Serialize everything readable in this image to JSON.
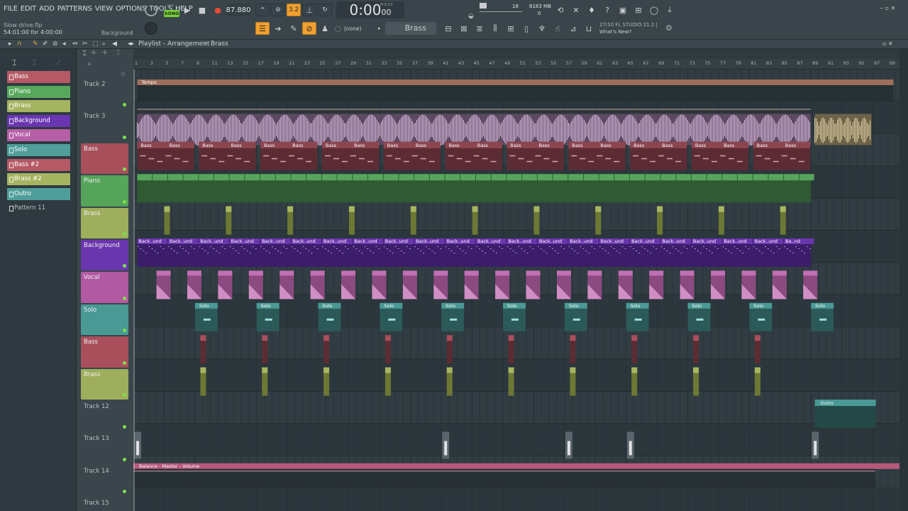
{
  "menu": {
    "items": [
      "FILE",
      "EDIT",
      "ADD",
      "PATTERNS",
      "VIEW",
      "OPTIONS",
      "TOOLS",
      "HELP"
    ]
  },
  "project": {
    "file": "Slow drive.flp",
    "time_range": "54:01:00 for 4:00:00",
    "hint_pattern": "Background"
  },
  "transport": {
    "song_label": "SONG",
    "pat_label": "PAT",
    "tempo": "87.880",
    "time": "0:00",
    "time_sub": "00",
    "time_unit": "M:S:CS",
    "step": "3.2"
  },
  "stats": {
    "cpu_value": "18",
    "memory": "6183 MB",
    "poly": "0"
  },
  "toolbar": {
    "pattern_select": "(none)",
    "channel_name": "Brass"
  },
  "news": {
    "line1": "27/10  FL STUDIO 21.2 |",
    "line2": "What's New?"
  },
  "playlist": {
    "breadcrumb_title": "Playlist - Arrangement",
    "breadcrumb_sep": "›",
    "breadcrumb_pattern": "Brass"
  },
  "patterns": [
    {
      "name": "Bass",
      "color": "#b55a65"
    },
    {
      "name": "Piano",
      "color": "#57a85c"
    },
    {
      "name": "Brass",
      "color": "#a5b460"
    },
    {
      "name": "Background",
      "color": "#6a36b0"
    },
    {
      "name": "Vocal",
      "color": "#b65fa6"
    },
    {
      "name": "Solo",
      "color": "#4f9e9a"
    },
    {
      "name": "Bass #2",
      "color": "#b55a65"
    },
    {
      "name": "Brass #2",
      "color": "#a5b460"
    },
    {
      "name": "Outro",
      "color": "#4f9e9a"
    },
    {
      "name": "Pattern 11",
      "color": ""
    }
  ],
  "tracks": [
    {
      "name": "Track 2",
      "color": ""
    },
    {
      "name": "Track 3",
      "color": ""
    },
    {
      "name": "Bass",
      "color": "#a84f5b"
    },
    {
      "name": "Piano",
      "color": "#55a45a"
    },
    {
      "name": "Brass",
      "color": "#9fae5c"
    },
    {
      "name": "Background",
      "color": "#6a36ae"
    },
    {
      "name": "Vocal",
      "color": "#b25aa1"
    },
    {
      "name": "Solo",
      "color": "#4a9995"
    },
    {
      "name": "Bass",
      "color": "#a84f5b"
    },
    {
      "name": "Brass",
      "color": "#9fae5c"
    },
    {
      "name": "Track 12",
      "color": ""
    },
    {
      "name": "Track 13",
      "color": ""
    },
    {
      "name": "Track 14",
      "color": ""
    },
    {
      "name": "Track 15",
      "color": ""
    }
  ],
  "ruler": [
    "1",
    "3",
    "5",
    "7",
    "9",
    "11",
    "13",
    "15",
    "17",
    "19",
    "21",
    "23",
    "25",
    "27",
    "29",
    "31",
    "33",
    "35",
    "37",
    "39",
    "41",
    "43",
    "45",
    "47",
    "49",
    "51",
    "53",
    "55",
    "57",
    "59",
    "61",
    "63",
    "65",
    "67",
    "69",
    "71",
    "73",
    "75",
    "77",
    "79",
    "81",
    "83",
    "85",
    "87",
    "89",
    "91",
    "93",
    "95",
    "97",
    "99"
  ],
  "clips": {
    "tempo": "Tempo",
    "bass": "Bass",
    "background": "Back..und",
    "background_last": "Ba..nd",
    "solo": "Solo",
    "outro": "Outro",
    "automation": "Balance - Master - Volume"
  }
}
